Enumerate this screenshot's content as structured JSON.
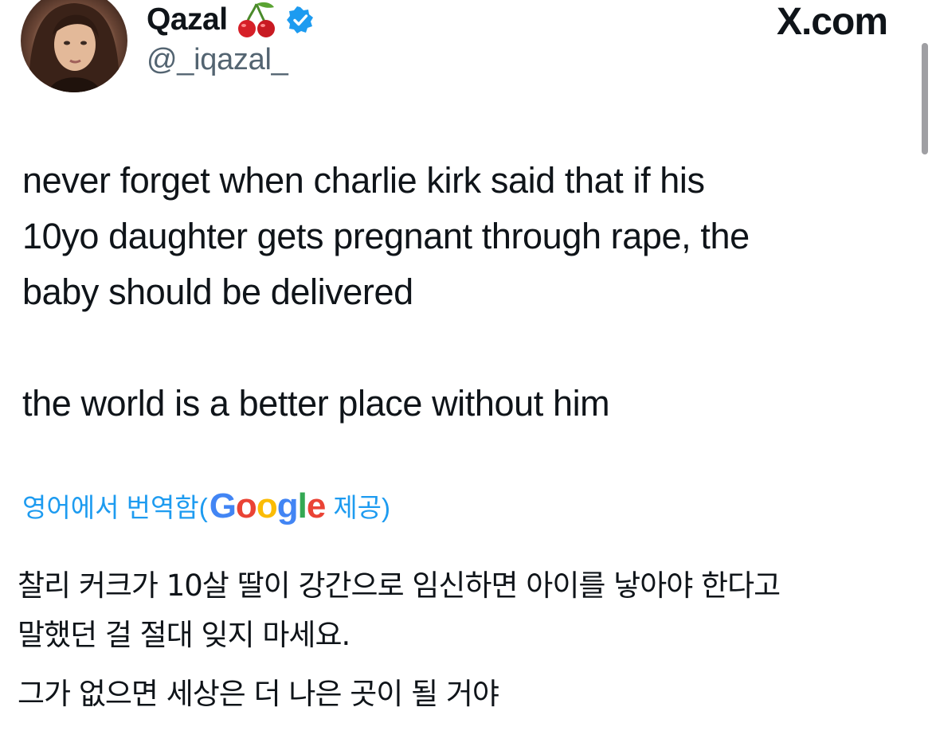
{
  "author": {
    "display_name": "Qazal",
    "handle": "@_iqazal_",
    "name_emoji_icon": "cherry-icon",
    "verified_icon": "verified-badge-icon",
    "avatar_icon": "profile-photo"
  },
  "header": {
    "site_label": "X.com"
  },
  "tweet": {
    "line1": "never forget when charlie kirk said that if his",
    "line2": "10yo daughter gets pregnant through rape, the",
    "line3": "baby should be delivered",
    "line4": "the world is a better place without him"
  },
  "translation": {
    "label_prefix": "영어에서 번역함(",
    "provider_g1": "G",
    "provider_o1": "o",
    "provider_o2": "o",
    "provider_g2": "g",
    "provider_l": "l",
    "provider_e": "e",
    "label_suffix": "제공)",
    "text_line1": "찰리 커크가 10살 딸이 강간으로 임신하면 아이를 낳아야 한다고",
    "text_line2": "말했던 걸 절대 잊지 마세요.",
    "text_line3": "그가 없으면 세상은 더 나은 곳이 될 거야"
  },
  "colors": {
    "link_blue": "#1d9bf0",
    "text": "#0f1419",
    "muted": "#536471",
    "verified": "#1d9bf0"
  }
}
